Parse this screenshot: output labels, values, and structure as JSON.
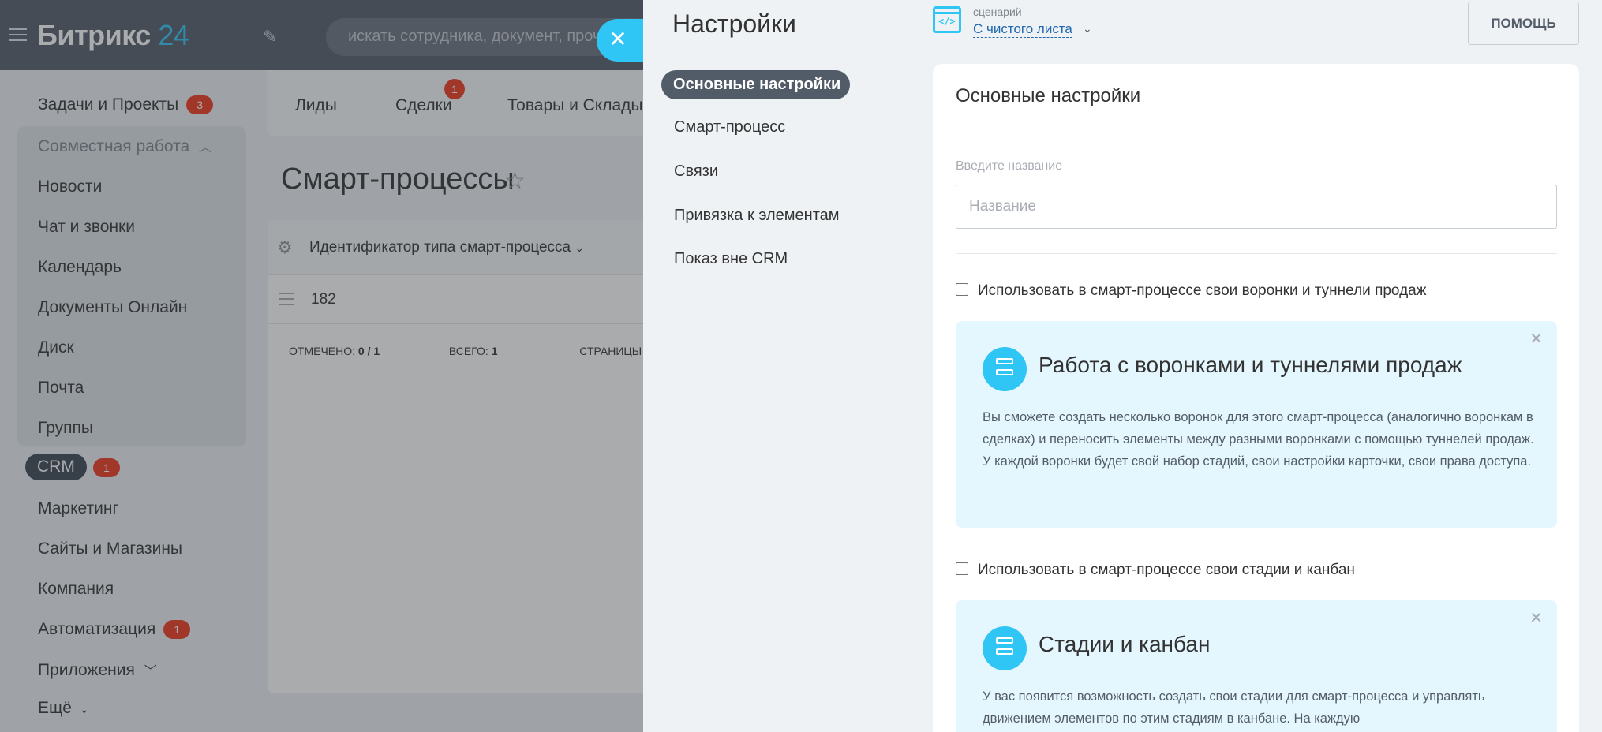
{
  "topbar": {
    "logo_text": "Битрикс",
    "logo_number": "24",
    "search_placeholder": "искать сотрудника, документ, прочее"
  },
  "left_menu": {
    "tasks": {
      "label": "Задачи и Проекты",
      "badge": "3"
    },
    "group_title": "Совместная работа",
    "group_items": [
      "Новости",
      "Чат и звонки",
      "Календарь",
      "Документы Онлайн",
      "Диск",
      "Почта",
      "Группы"
    ],
    "crm": {
      "label": "CRM",
      "badge": "1"
    },
    "marketing": "Маркетинг",
    "sites": "Сайты и Магазины",
    "company": "Компания",
    "automation": {
      "label": "Автоматизация",
      "badge": "1"
    },
    "apps": "Приложения",
    "more": "Ещё"
  },
  "crm_tabs": {
    "items": [
      "Лиды",
      "Сделки",
      "Товары и Склады"
    ],
    "deals_badge": "1"
  },
  "page": {
    "title": "Смарт-процессы"
  },
  "grid": {
    "column_header": "Идентификатор типа смарт-процесса",
    "row_id": "182",
    "footer": {
      "selected_label": "ОТМЕЧЕНО:",
      "selected_value": "0 / 1",
      "total_label": "ВСЕГО:",
      "total_value": "1",
      "pages_label": "СТРАНИЦЫ"
    }
  },
  "slider": {
    "title": "Настройки",
    "nav": [
      "Основные настройки",
      "Смарт-процесс",
      "Связи",
      "Привязка к элементам",
      "Показ вне CRM"
    ],
    "scenario": {
      "label": "сценарий",
      "value": "С чистого листа"
    },
    "help_button": "ПОМОЩЬ",
    "card": {
      "title": "Основные настройки",
      "name_label": "Введите название",
      "name_placeholder": "Название",
      "name_value": "",
      "checkbox1": "Использовать в смарт-процессе свои воронки и туннели продаж",
      "info1": {
        "title": "Работа с воронками и туннелями продаж",
        "text": "Вы сможете создать несколько воронок для этого смарт-процесса (аналогично воронкам в сделках) и переносить элементы между разными воронками с помощью туннелей продаж. У каждой воронки будет свой набор стадий, свои настройки карточки, свои права доступа."
      },
      "checkbox2": "Использовать в смарт-процессе свои стадии и канбан",
      "info2": {
        "title": "Стадии и канбан",
        "text": "У вас появится возможность создать свои стадии для смарт-процесса и управлять движением элементов по этим стадиям в канбане. На каждую"
      }
    }
  },
  "colors": {
    "accent": "#2fc6f6",
    "topbar": "#535c69",
    "badge": "#f0371b",
    "nav_active": "#525c69",
    "info_bg": "#e5f7fe"
  }
}
